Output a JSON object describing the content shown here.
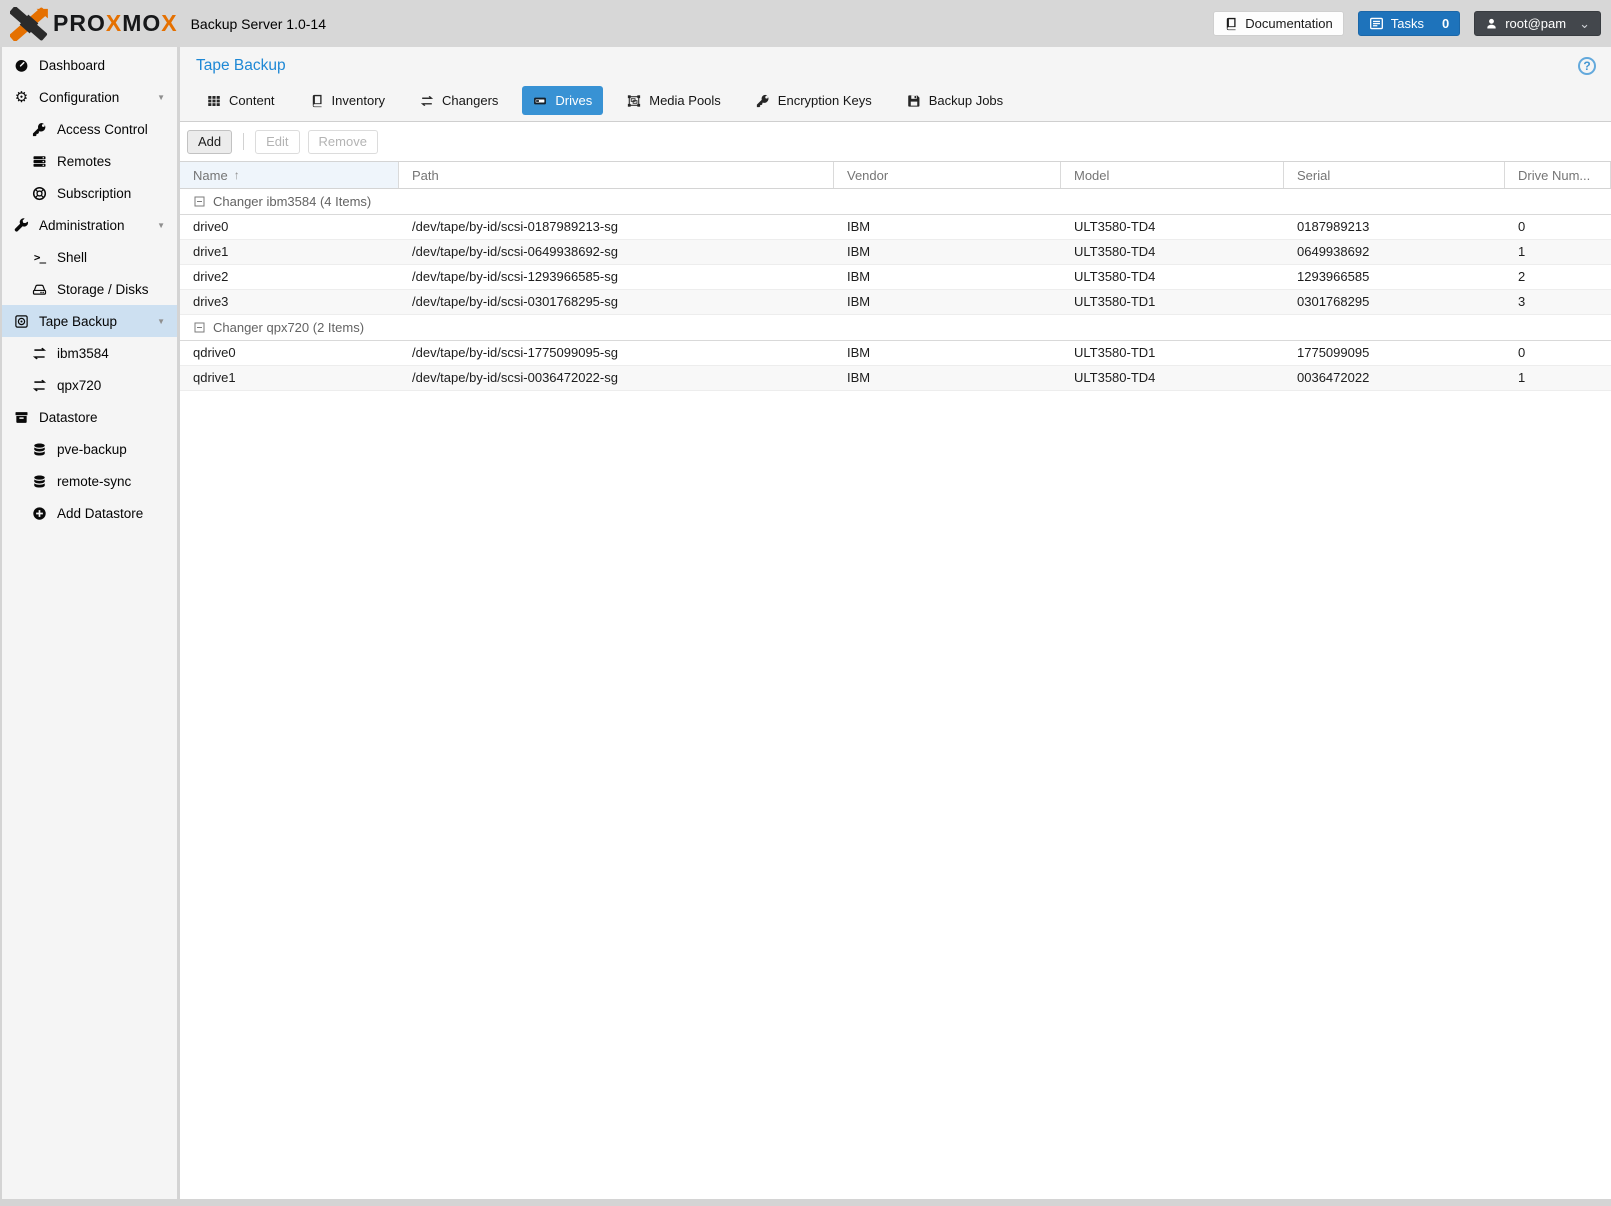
{
  "topbar": {
    "brand": {
      "pre": "PRO",
      "x1": "X",
      "mid": "MO",
      "x2": "X"
    },
    "subtitle": "Backup Server 1.0-14",
    "documentation_label": "Documentation",
    "tasks_label": "Tasks",
    "tasks_count": "0",
    "user_label": "root@pam"
  },
  "sidebar": {
    "items": [
      {
        "label": "Dashboard",
        "icon": "tachometer-icon",
        "level": 0,
        "selected": false,
        "expandable": false
      },
      {
        "label": "Configuration",
        "icon": "gear-icon",
        "level": 0,
        "selected": false,
        "expandable": true
      },
      {
        "label": "Access Control",
        "icon": "key-icon",
        "level": 1,
        "selected": false,
        "expandable": false
      },
      {
        "label": "Remotes",
        "icon": "server-icon",
        "level": 1,
        "selected": false,
        "expandable": false
      },
      {
        "label": "Subscription",
        "icon": "life-ring-icon",
        "level": 1,
        "selected": false,
        "expandable": false
      },
      {
        "label": "Administration",
        "icon": "wrench-icon",
        "level": 0,
        "selected": false,
        "expandable": true
      },
      {
        "label": "Shell",
        "icon": "terminal-icon",
        "level": 1,
        "selected": false,
        "expandable": false
      },
      {
        "label": "Storage / Disks",
        "icon": "hdd-icon",
        "level": 1,
        "selected": false,
        "expandable": false
      },
      {
        "label": "Tape Backup",
        "icon": "tape-icon",
        "level": 0,
        "selected": true,
        "expandable": true
      },
      {
        "label": "ibm3584",
        "icon": "exchange-icon",
        "level": 1,
        "selected": false,
        "expandable": false
      },
      {
        "label": "qpx720",
        "icon": "exchange-icon",
        "level": 1,
        "selected": false,
        "expandable": false
      },
      {
        "label": "Datastore",
        "icon": "archive-icon",
        "level": 0,
        "selected": false,
        "expandable": false
      },
      {
        "label": "pve-backup",
        "icon": "database-icon",
        "level": 1,
        "selected": false,
        "expandable": false
      },
      {
        "label": "remote-sync",
        "icon": "database-icon",
        "level": 1,
        "selected": false,
        "expandable": false
      },
      {
        "label": "Add Datastore",
        "icon": "plus-circle-icon",
        "level": 1,
        "selected": false,
        "expandable": false
      }
    ]
  },
  "content": {
    "title": "Tape Backup",
    "help_icon": "?",
    "tabs": [
      {
        "label": "Content",
        "icon": "grid-icon",
        "active": false
      },
      {
        "label": "Inventory",
        "icon": "book-icon",
        "active": false
      },
      {
        "label": "Changers",
        "icon": "exchange-icon",
        "active": false
      },
      {
        "label": "Drives",
        "icon": "tape-drive-icon",
        "active": true
      },
      {
        "label": "Media Pools",
        "icon": "object-group-icon",
        "active": false
      },
      {
        "label": "Encryption Keys",
        "icon": "key-icon",
        "active": false
      },
      {
        "label": "Backup Jobs",
        "icon": "save-icon",
        "active": false
      }
    ],
    "toolbar": {
      "add_label": "Add",
      "edit_label": "Edit",
      "remove_label": "Remove"
    },
    "table": {
      "columns": [
        "Name",
        "Path",
        "Vendor",
        "Model",
        "Serial",
        "Drive Num..."
      ],
      "sorted_column": "Name",
      "sort_direction": "ascending",
      "groups": [
        {
          "label": "Changer ibm3584 (4 Items)",
          "rows": [
            [
              "drive0",
              "/dev/tape/by-id/scsi-0187989213-sg",
              "IBM",
              "ULT3580-TD4",
              "0187989213",
              "0"
            ],
            [
              "drive1",
              "/dev/tape/by-id/scsi-0649938692-sg",
              "IBM",
              "ULT3580-TD4",
              "0649938692",
              "1"
            ],
            [
              "drive2",
              "/dev/tape/by-id/scsi-1293966585-sg",
              "IBM",
              "ULT3580-TD4",
              "1293966585",
              "2"
            ],
            [
              "drive3",
              "/dev/tape/by-id/scsi-0301768295-sg",
              "IBM",
              "ULT3580-TD1",
              "0301768295",
              "3"
            ]
          ]
        },
        {
          "label": "Changer qpx720 (2 Items)",
          "rows": [
            [
              "qdrive0",
              "/dev/tape/by-id/scsi-1775099095-sg",
              "IBM",
              "ULT3580-TD1",
              "1775099095",
              "0"
            ],
            [
              "qdrive1",
              "/dev/tape/by-id/scsi-0036472022-sg",
              "IBM",
              "ULT3580-TD4",
              "0036472022",
              "1"
            ]
          ]
        }
      ]
    }
  },
  "colors": {
    "accent_blue": "#3892d4",
    "tasks_button_blue": "#1e73bb",
    "title_blue": "#1e88d5",
    "selected_nav_bg": "#cde0f1",
    "logo_orange": "#e57000",
    "topbar_bg": "#d7d7d7",
    "sidebar_bg": "#f5f5f5"
  }
}
